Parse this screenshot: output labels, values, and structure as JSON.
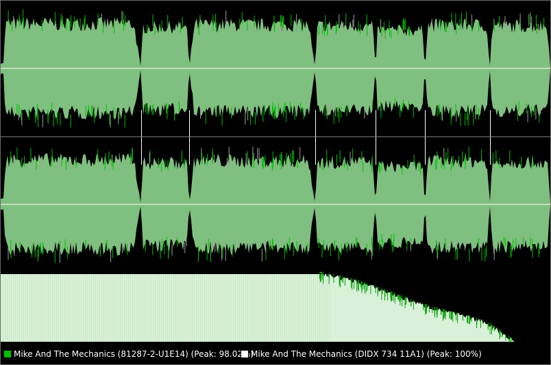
{
  "colors": {
    "background": "#000000",
    "waveform_fill": "#7fbf7f",
    "waveform_primary": "#00c000",
    "waveform_secondary": "#a0a0a0",
    "centerline": "#d7ecd7",
    "channel_divider": "#8a8a8a",
    "spectrum_fill": "#d9f0d9",
    "spectrum_primary": "#00a000"
  },
  "legend": {
    "primary": {
      "label": "Mike And The Mechanics (81287-2-U1E14) (Peak: 98.02%)",
      "color": "#00c000",
      "icon": "square-swatch-icon"
    },
    "secondary": {
      "label": "Mike And The Mechanics (DIDX 734 11A1) (Peak: 100%)",
      "color": "#ffffff",
      "icon": "square-swatch-icon"
    }
  },
  "chart_data": [
    {
      "type": "area",
      "name": "waveform overview (two channels)",
      "channels": 2,
      "series": [
        {
          "name": "Mike And The Mechanics (81287-2-U1E14)",
          "peak_percent": 98.02
        },
        {
          "name": "Mike And The Mechanics (DIDX 734 11A1)",
          "peak_percent": 100
        }
      ],
      "tracks": [
        {
          "index": 1,
          "start": 0.0,
          "end": 0.255,
          "level": 0.82
        },
        {
          "index": 2,
          "start": 0.255,
          "end": 0.343,
          "level": 0.76
        },
        {
          "index": 3,
          "start": 0.343,
          "end": 0.572,
          "level": 0.8
        },
        {
          "index": 4,
          "start": 0.572,
          "end": 0.682,
          "level": 0.78
        },
        {
          "index": 5,
          "start": 0.682,
          "end": 0.772,
          "level": 0.7
        },
        {
          "index": 6,
          "start": 0.772,
          "end": 0.89,
          "level": 0.8
        },
        {
          "index": 7,
          "start": 0.89,
          "end": 1.0,
          "level": 0.78
        }
      ]
    },
    {
      "type": "area",
      "name": "spectrum comparison",
      "profile": [
        [
          0.0,
          1.0
        ],
        [
          0.58,
          1.0
        ],
        [
          0.6,
          0.98
        ],
        [
          0.64,
          0.9
        ],
        [
          0.68,
          0.8
        ],
        [
          0.72,
          0.68
        ],
        [
          0.76,
          0.56
        ],
        [
          0.8,
          0.46
        ],
        [
          0.84,
          0.38
        ],
        [
          0.88,
          0.29
        ],
        [
          0.9,
          0.2
        ],
        [
          0.92,
          0.08
        ],
        [
          0.935,
          0.0
        ]
      ]
    }
  ]
}
